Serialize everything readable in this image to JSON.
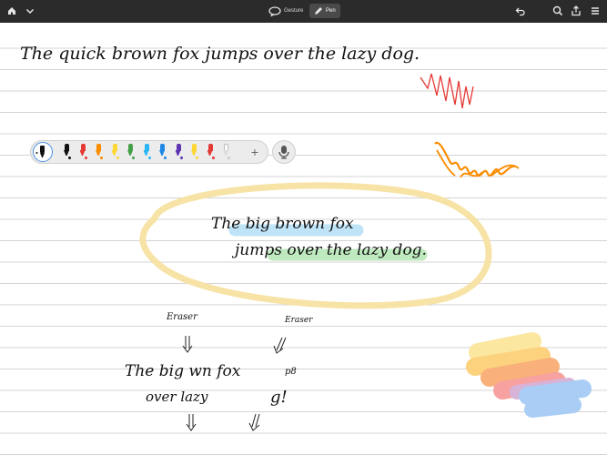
{
  "toolbar": {
    "gesture_label": "Gesture",
    "pen_label": "Pen"
  },
  "note": {
    "line1": "The quick brown fox jumps over the lazy dog.",
    "circled_line1": "The big brown fox",
    "circled_line2": "jumps over the lazy dog.",
    "eraser_left": "Eraser",
    "eraser_right": "Eraser",
    "erased_line1": "The big    wn fox",
    "erased_line2": "over     lazy",
    "erased_mark": "g!",
    "erased_tail": "p8"
  },
  "palette": {
    "pens": [
      {
        "color": "#111111"
      },
      {
        "color": "#e53935"
      },
      {
        "color": "#fb8c00"
      },
      {
        "color": "#fdd835"
      },
      {
        "color": "#43a047"
      },
      {
        "color": "#29b6f6"
      },
      {
        "color": "#1e88e5"
      },
      {
        "color": "#5e35b1"
      },
      {
        "color": "#fdd835"
      },
      {
        "color": "#e53935"
      },
      {
        "color": "#ffffff"
      }
    ],
    "add_label": "+"
  },
  "colors": {
    "toolbar_bg": "#2b2b2b",
    "highlight_blue": "#bfe3f7",
    "highlight_green": "#bfe9bf",
    "lasso": "#f7e3a6"
  }
}
